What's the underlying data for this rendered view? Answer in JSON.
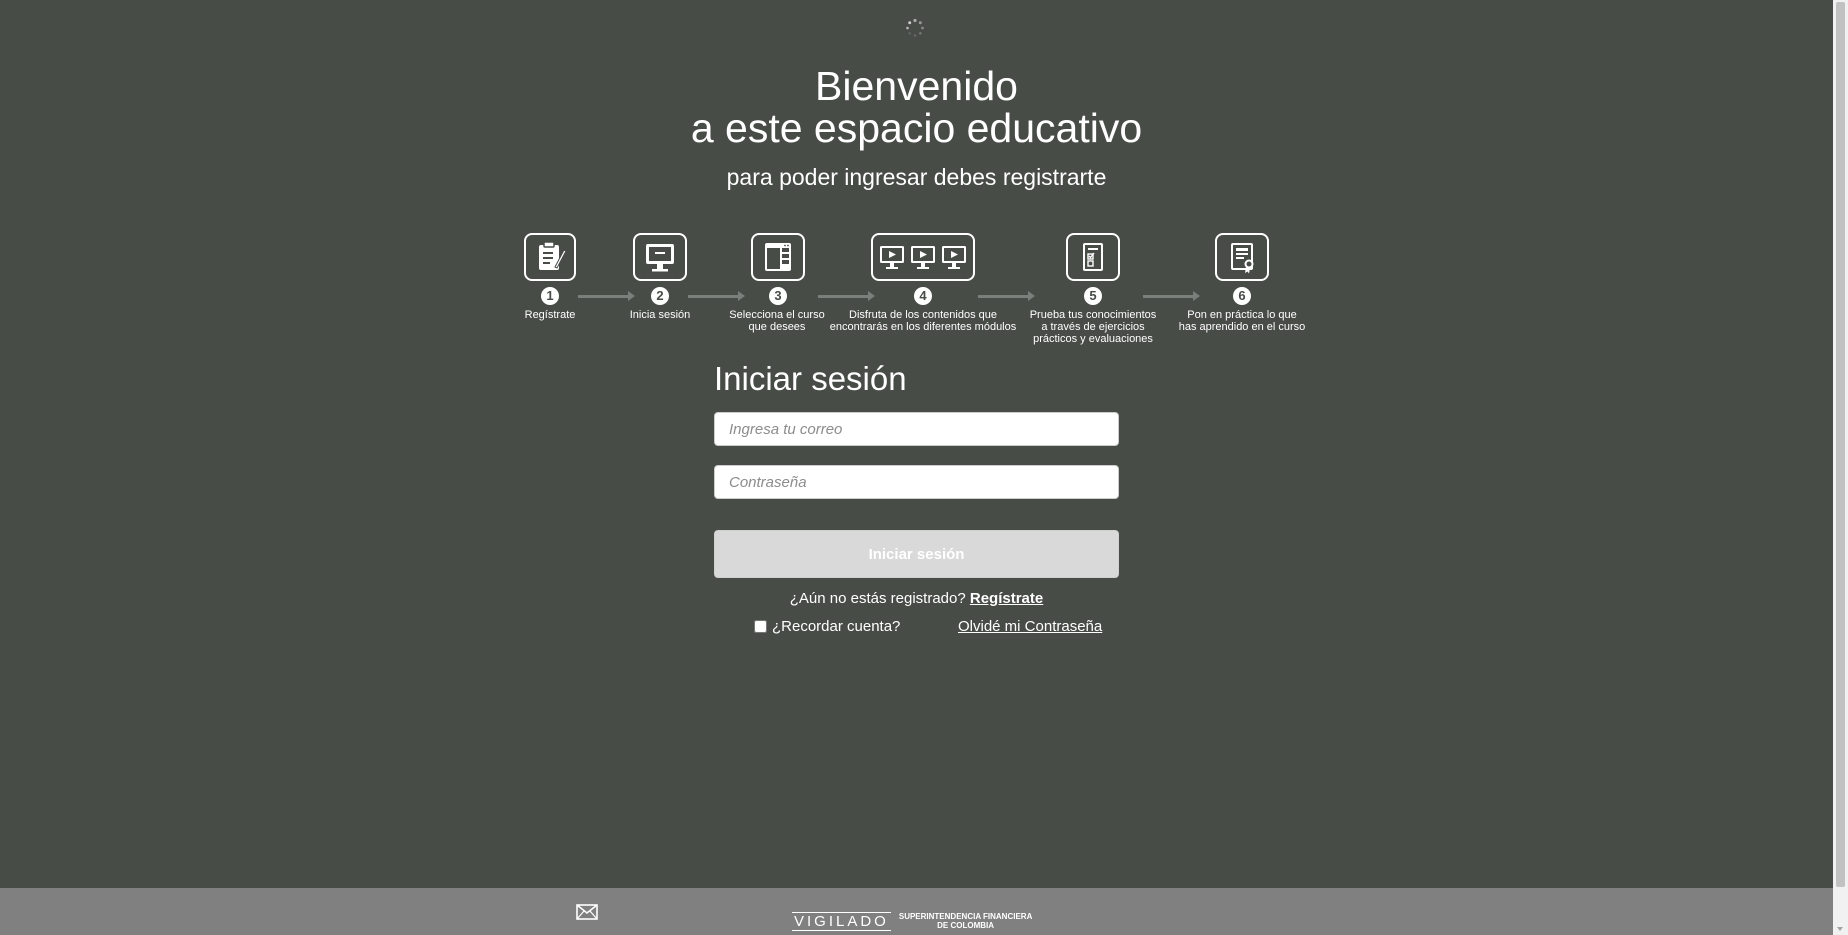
{
  "header": {
    "title_line1": "Bienvenido",
    "title_line2": "a este espacio educativo",
    "subtitle": "para poder ingresar debes registrarte"
  },
  "steps": [
    {
      "number": "1",
      "label": "Regístrate",
      "icon": "clipboard-pen-icon"
    },
    {
      "number": "2",
      "label": "Inicia sesión",
      "icon": "monitor-icon"
    },
    {
      "number": "3",
      "label": "Selecciona el curso\nque desees",
      "icon": "course-layout-icon"
    },
    {
      "number": "4",
      "label": "Disfruta de los contenidos que\nencontrarás en los diferentes módulos",
      "icon": "video-monitors-icon"
    },
    {
      "number": "5",
      "label": "Prueba tus conocimientos\na través de ejercicios\nprácticos y evaluaciones",
      "icon": "quiz-sheet-icon"
    },
    {
      "number": "6",
      "label": "Pon en práctica lo que\nhas aprendido en el curso",
      "icon": "certificate-icon"
    }
  ],
  "login": {
    "title": "Iniciar sesión",
    "email_placeholder": "Ingresa tu correo",
    "password_placeholder": "Contraseña",
    "submit_label": "Iniciar sesión",
    "not_registered_text": "¿Aún no estás registrado?",
    "register_link": "Regístrate",
    "remember_label": "¿Recordar cuenta?",
    "forgot_link": "Olvidé mi Contraseña"
  },
  "footer": {
    "mail_icon": "envelope-icon",
    "vigilado": "VIGILADO",
    "vigilado_entity": "SUPERINTENDENCIA FINANCIERA\nDE COLOMBIA"
  },
  "colors": {
    "background": "#474c47",
    "footer": "#808080",
    "button_disabled": "#d9d9d9"
  }
}
